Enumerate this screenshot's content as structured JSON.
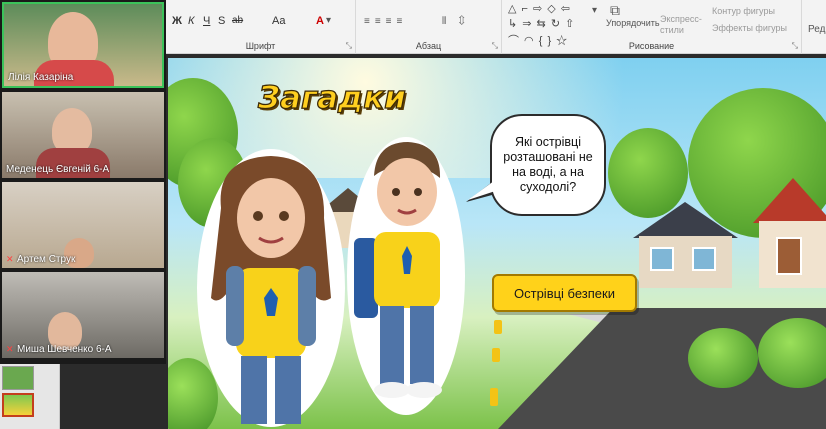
{
  "ribbon": {
    "font_group_label": "Шрифт",
    "font_buttons": [
      "Ж",
      "К",
      "Ч",
      "S",
      "ab",
      "Aa",
      "A"
    ],
    "paragraph_group_label": "Абзац",
    "drawing_group_label": "Рисование",
    "arrange_label": "Упорядочить",
    "quick_styles_label": "Экспресс-стили",
    "shape_outline_label": "Контур фигуры",
    "shape_effects_label": "Эффекты фигуры",
    "edit_label": "Ред"
  },
  "slide": {
    "title": "Загадки",
    "question": "Які острівці розташовані не на воді, а на суходолі?",
    "answer_button": "Острівці безпеки"
  },
  "participants": [
    {
      "name": "Лілія Казаріна",
      "speaking": true,
      "muted": false
    },
    {
      "name": "Меденець Євгеній 6-А",
      "speaking": false,
      "muted": false
    },
    {
      "name": "Артем Струк",
      "speaking": false,
      "muted": true
    },
    {
      "name": "Миша Шевченко 6-А",
      "speaking": false,
      "muted": true
    }
  ],
  "colors": {
    "accent_yellow": "#ffd21a",
    "speaking_border": "#3bc35a",
    "mic_off": "#ff4040",
    "active_thumb_border": "#c43e1c"
  }
}
